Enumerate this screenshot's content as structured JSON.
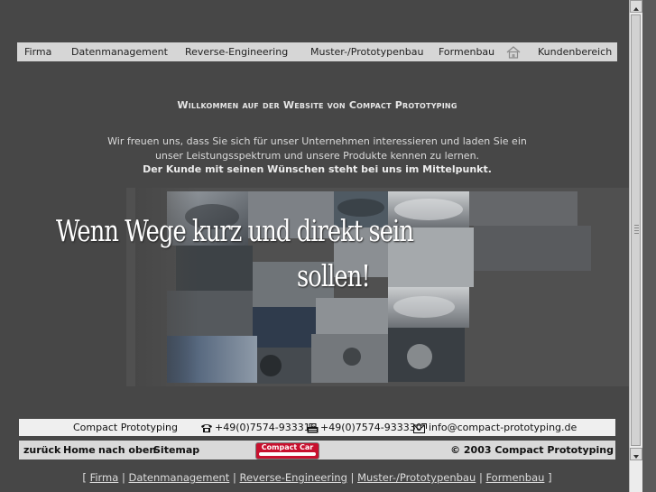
{
  "nav": {
    "items": [
      "Firma",
      "Datenmanagement",
      "Reverse-Engineering",
      "Muster-/Prototypenbau",
      "Formenbau",
      "Kundenbereich"
    ],
    "home_icon": "house-icon"
  },
  "main": {
    "welcome": "Willkommen auf der Website von Compact Prototyping",
    "intro_line1": "Wir freuen uns, dass Sie sich für unser Unternehmen interessieren und laden Sie ein",
    "intro_line2": "unser Leistungsspektrum und unsere Produkte kennen zu lernen.",
    "intro_line3": "Der Kunde mit seinen Wünschen steht bei uns im Mittelpunkt.",
    "slogan_line1": "Wenn Wege kurz und direkt sein",
    "slogan_line2": "sollen!"
  },
  "contact": {
    "company": "Compact Prototyping",
    "phone": "+49(0)7574-933316",
    "fax": "+49(0)7574-933330",
    "email": "info@compact-prototyping.de",
    "phone_icon": "telephone-icon",
    "fax_icon": "fax-icon",
    "email_icon": "mail-icon"
  },
  "bottom": {
    "back": "zurück",
    "home": "Home",
    "top": "nach oben",
    "sitemap": "Sitemap",
    "logo_text": "Compact Car",
    "copyright": "© 2003 Compact Prototyping"
  },
  "footer": {
    "open": "[",
    "close": "]",
    "sep": "|",
    "links": [
      "Firma",
      "Datenmanagement",
      "Reverse-Engineering",
      "Muster-/Prototypenbau",
      "Formenbau"
    ]
  },
  "colors": {
    "background": "#474747",
    "nav_bar": "#d6d6d6",
    "contact_bar": "#efefef",
    "logo_red": "#c8102e"
  }
}
